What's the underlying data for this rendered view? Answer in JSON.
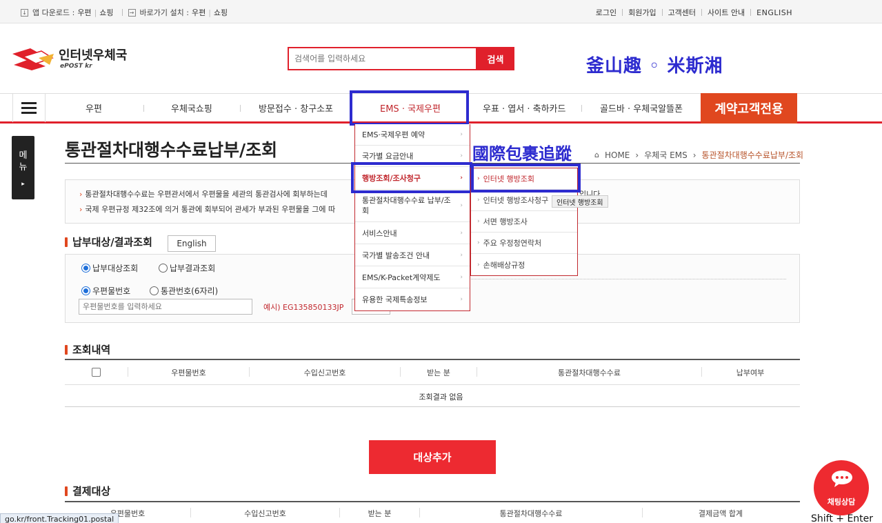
{
  "topbar": {
    "app_download_label": "앱 다운로드 :",
    "app_links": [
      "우편",
      "쇼핑"
    ],
    "shortcut_label": "바로가기 설치 :",
    "shortcut_links": [
      "우편",
      "쇼핑"
    ],
    "right_links": [
      "로그인",
      "회원가입",
      "고객센터",
      "사이트 안내",
      "ENGLISH"
    ]
  },
  "header": {
    "logo_title": "인터넷우체국",
    "logo_sub": "ePOST kr",
    "search_placeholder": "검색어를 입력하세요",
    "search_button": "검색",
    "annotation": "釜山趣 ◦ 米斯湘"
  },
  "nav": {
    "items": [
      "우편",
      "우체국쇼핑",
      "방문접수 · 창구소포",
      "EMS · 국제우편",
      "우표 · 엽서 · 축하카드",
      "골드바 · 우체국알뜰폰"
    ],
    "emphasis": "계약고객전용",
    "side_tab": "메뉴"
  },
  "dropdown": {
    "items": [
      "EMS·국제우편 예약",
      "국가별 요금안내",
      "행방조회/조사청구",
      "통관절차대행수수료 납부/조회",
      "서비스안내",
      "국가별 발송조건 안내",
      "EMS/K-Packet계약제도",
      "유용한 국제특송정보"
    ],
    "active_index": 2
  },
  "submenu": {
    "items": [
      "인터넷 행방조회",
      "인터넷 행방조사청구",
      "서면 행방조사",
      "주요 우정청연락처",
      "손해배상규정"
    ],
    "tooltip": "인터넷 행방조회"
  },
  "page": {
    "title": "통관절차대행수수료납부/조회",
    "annotation": "國際包裹追蹤",
    "breadcrumb": [
      "HOME",
      "우체국 EMS",
      "통관절차대행수수료납부/조회"
    ],
    "info_lines": [
      "통관절차대행수수료는 우편관서에서 우편물을 세관의 통관검사에 회부하는데",
      "국제 우편규정 제32조에 의거 통관에 회부되어 관세가 부과된 우편물을 그에 따"
    ],
    "info_tail": "입니다"
  },
  "form": {
    "section_title": "납부대상/결과조회",
    "english_button": "English",
    "radio_target": "납부대상조회",
    "radio_result": "납부결과조회",
    "radio_mail": "우편물번호",
    "radio_customs": "통관번호(6자리)",
    "mail_placeholder": "우편물번호를 입력하세요",
    "example": "예시) EG135850133JP"
  },
  "results": {
    "section_title": "조회내역",
    "columns": [
      "우편물번호",
      "수입신고번호",
      "받는 분",
      "통관절차대행수수료",
      "납부여부"
    ],
    "empty": "조회결과 없음",
    "add_button": "대상추가"
  },
  "payment": {
    "section_title": "결제대상",
    "columns": [
      "우편물번호",
      "수입신고번호",
      "받는 분",
      "통관절차대행수수료",
      "결제금액 합계"
    ]
  },
  "chat": {
    "label": "채팅상담",
    "hint": "Shift + Enter"
  },
  "status_url": "go.kr/front.Tracking01.postal",
  "colors": {
    "brand_red": "#e0202b",
    "annotation_blue": "#2d2bcf",
    "emphasis_orange": "#e0471f"
  }
}
